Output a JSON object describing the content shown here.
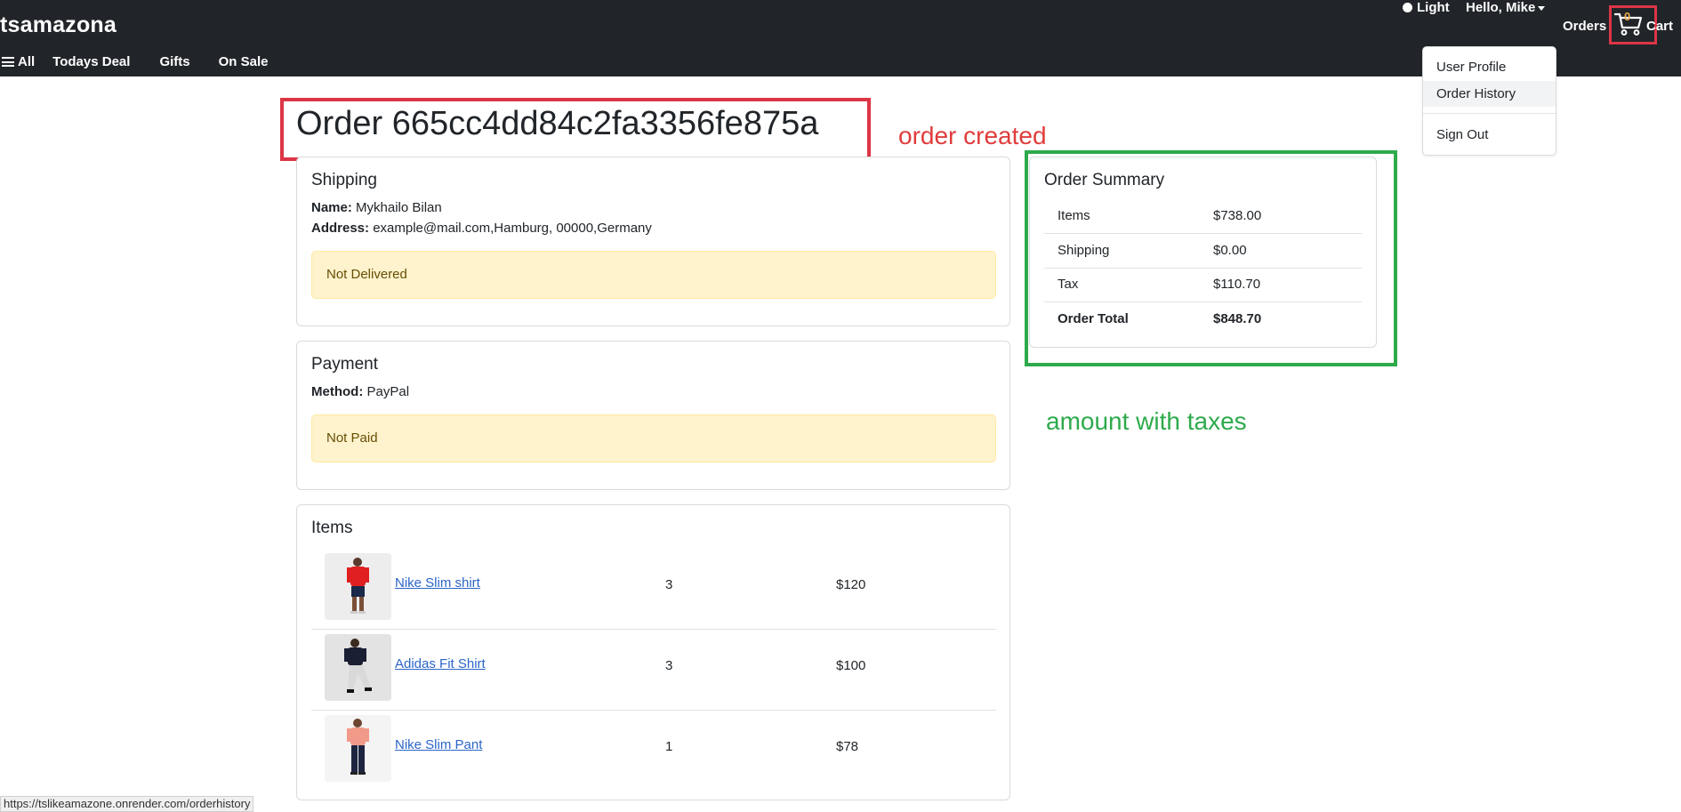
{
  "header": {
    "brand": "tsamazona",
    "theme_label": "Light",
    "user_menu_label": "Hello, Mike",
    "orders_label": "Orders",
    "cart_count": "0",
    "cart_label": "Cart",
    "nav": {
      "all": "All",
      "todays_deal": "Todays Deal",
      "gifts": "Gifts",
      "on_sale": "On Sale"
    }
  },
  "user_dropdown": {
    "items": [
      "User Profile",
      "Order History",
      "Sign Out"
    ],
    "active": "Order History"
  },
  "order": {
    "title": "Order 665cc4dd84c2fa3356fe875a"
  },
  "annotations": {
    "order_created": "order created",
    "amount_with_taxes": "amount with taxes"
  },
  "shipping": {
    "heading": "Shipping",
    "name_label": "Name:",
    "name_value": "Mykhailo Bilan",
    "address_label": "Address:",
    "address_value": "example@mail.com,Hamburg, 00000,Germany",
    "status": "Not Delivered"
  },
  "payment": {
    "heading": "Payment",
    "method_label": "Method:",
    "method_value": "PayPal",
    "status": "Not Paid"
  },
  "items": {
    "heading": "Items",
    "rows": [
      {
        "name": "Nike Slim shirt",
        "qty": "3",
        "price": "$120"
      },
      {
        "name": "Adidas Fit Shirt",
        "qty": "3",
        "price": "$100"
      },
      {
        "name": "Nike Slim Pant",
        "qty": "1",
        "price": "$78"
      }
    ]
  },
  "summary": {
    "heading": "Order Summary",
    "rows": [
      {
        "label": "Items",
        "value": "$738.00"
      },
      {
        "label": "Shipping",
        "value": "$0.00"
      },
      {
        "label": "Tax",
        "value": "$110.70"
      },
      {
        "label": "Order Total",
        "value": "$848.70"
      }
    ]
  },
  "status_bar": {
    "url": "https://tslikeamazone.onrender.com/orderhistory"
  },
  "colors": {
    "navbar": "#212529",
    "annotation_red": "#dc3545",
    "annotation_green": "#2eaa4c",
    "alert_bg": "#fff3cd",
    "link": "#2b65c8",
    "cart_count": "#f0ad4e"
  }
}
